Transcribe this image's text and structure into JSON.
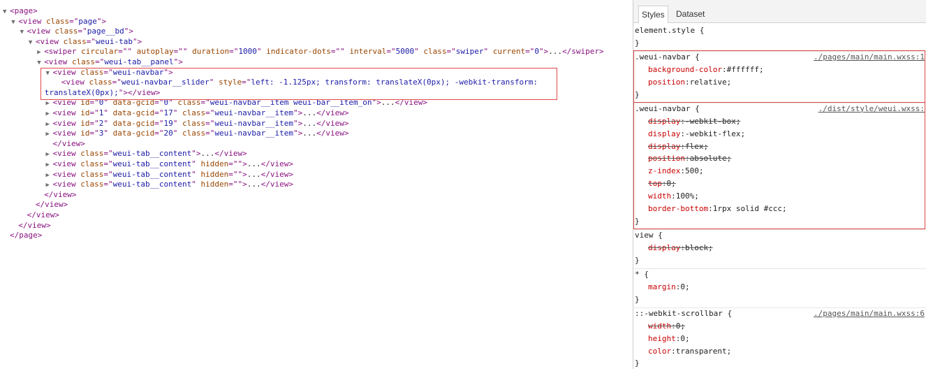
{
  "elements_panel": {
    "lines": [
      {
        "indent": 0,
        "toggle": "down",
        "html": [
          [
            "t",
            "<page>"
          ]
        ]
      },
      {
        "indent": 1,
        "toggle": "down",
        "html": [
          [
            "t",
            "<view "
          ],
          [
            "a",
            "class"
          ],
          [
            "t",
            "=\""
          ],
          [
            "v",
            "page"
          ],
          [
            "t",
            "\">"
          ]
        ]
      },
      {
        "indent": 2,
        "toggle": "down",
        "html": [
          [
            "t",
            "<view "
          ],
          [
            "a",
            "class"
          ],
          [
            "t",
            "=\""
          ],
          [
            "v",
            "page__bd"
          ],
          [
            "t",
            "\">"
          ]
        ]
      },
      {
        "indent": 3,
        "toggle": "down",
        "html": [
          [
            "t",
            "<view "
          ],
          [
            "a",
            "class"
          ],
          [
            "t",
            "=\""
          ],
          [
            "v",
            "weui-tab"
          ],
          [
            "t",
            "\">"
          ]
        ]
      },
      {
        "indent": 4,
        "toggle": "right",
        "html": [
          [
            "t",
            "<swiper "
          ],
          [
            "a",
            "circular"
          ],
          [
            "t",
            "=\"\" "
          ],
          [
            "a",
            "autoplay"
          ],
          [
            "t",
            "=\"\" "
          ],
          [
            "a",
            "duration"
          ],
          [
            "t",
            "=\""
          ],
          [
            "v",
            "1000"
          ],
          [
            "t",
            "\" "
          ],
          [
            "a",
            "indicator-dots"
          ],
          [
            "t",
            "=\"\" "
          ],
          [
            "a",
            "interval"
          ],
          [
            "t",
            "=\""
          ],
          [
            "v",
            "5000"
          ],
          [
            "t",
            "\" "
          ],
          [
            "a",
            "class"
          ],
          [
            "t",
            "=\""
          ],
          [
            "v",
            "swiper"
          ],
          [
            "t",
            "\" "
          ],
          [
            "a",
            "current"
          ],
          [
            "t",
            "=\""
          ],
          [
            "v",
            "0"
          ],
          [
            "t",
            "\">"
          ],
          [
            "x",
            "..."
          ],
          [
            "t",
            "</swiper>"
          ]
        ]
      },
      {
        "indent": 4,
        "toggle": "down",
        "html": [
          [
            "t",
            "<view "
          ],
          [
            "a",
            "class"
          ],
          [
            "t",
            "=\""
          ],
          [
            "v",
            "weui-tab__panel"
          ],
          [
            "t",
            "\">"
          ]
        ]
      },
      {
        "indent": 5,
        "toggle": "down",
        "html": [
          [
            "t",
            "<view "
          ],
          [
            "a",
            "class"
          ],
          [
            "t",
            "=\""
          ],
          [
            "v",
            "weui-navbar"
          ],
          [
            "t",
            "\">"
          ]
        ]
      },
      {
        "indent": 6,
        "toggle": "",
        "html": [
          [
            "t",
            "<view "
          ],
          [
            "a",
            "class"
          ],
          [
            "t",
            "=\""
          ],
          [
            "v",
            "weui-navbar__slider"
          ],
          [
            "t",
            "\" "
          ],
          [
            "a",
            "style"
          ],
          [
            "t",
            "=\""
          ],
          [
            "v",
            "left: -1.125px; transform: translateX(0px); -webkit-transform:"
          ]
        ]
      },
      {
        "indent": 6,
        "toggle": "",
        "html": [
          [
            "v",
            "translateX(0px);"
          ],
          [
            "t",
            "\"></view>"
          ]
        ]
      },
      {
        "indent": 5,
        "toggle": "right",
        "html": [
          [
            "t",
            "<view "
          ],
          [
            "a",
            "id"
          ],
          [
            "t",
            "=\""
          ],
          [
            "v",
            "0"
          ],
          [
            "t",
            "\" "
          ],
          [
            "a",
            "data-gcid"
          ],
          [
            "t",
            "=\""
          ],
          [
            "v",
            "0"
          ],
          [
            "t",
            "\" "
          ],
          [
            "a",
            "class"
          ],
          [
            "t",
            "=\""
          ],
          [
            "v",
            "weui-navbar__item weui-bar__item_on"
          ],
          [
            "t",
            "\">"
          ],
          [
            "x",
            "..."
          ],
          [
            "t",
            "</view>"
          ]
        ]
      },
      {
        "indent": 5,
        "toggle": "right",
        "html": [
          [
            "t",
            "<view "
          ],
          [
            "a",
            "id"
          ],
          [
            "t",
            "=\""
          ],
          [
            "v",
            "1"
          ],
          [
            "t",
            "\" "
          ],
          [
            "a",
            "data-gcid"
          ],
          [
            "t",
            "=\""
          ],
          [
            "v",
            "17"
          ],
          [
            "t",
            "\" "
          ],
          [
            "a",
            "class"
          ],
          [
            "t",
            "=\""
          ],
          [
            "v",
            "weui-navbar__item"
          ],
          [
            "t",
            "\">"
          ],
          [
            "x",
            "..."
          ],
          [
            "t",
            "</view>"
          ]
        ]
      },
      {
        "indent": 5,
        "toggle": "right",
        "html": [
          [
            "t",
            "<view "
          ],
          [
            "a",
            "id"
          ],
          [
            "t",
            "=\""
          ],
          [
            "v",
            "2"
          ],
          [
            "t",
            "\" "
          ],
          [
            "a",
            "data-gcid"
          ],
          [
            "t",
            "=\""
          ],
          [
            "v",
            "19"
          ],
          [
            "t",
            "\" "
          ],
          [
            "a",
            "class"
          ],
          [
            "t",
            "=\""
          ],
          [
            "v",
            "weui-navbar__item"
          ],
          [
            "t",
            "\">"
          ],
          [
            "x",
            "..."
          ],
          [
            "t",
            "</view>"
          ]
        ]
      },
      {
        "indent": 5,
        "toggle": "right",
        "html": [
          [
            "t",
            "<view "
          ],
          [
            "a",
            "id"
          ],
          [
            "t",
            "=\""
          ],
          [
            "v",
            "3"
          ],
          [
            "t",
            "\" "
          ],
          [
            "a",
            "data-gcid"
          ],
          [
            "t",
            "=\""
          ],
          [
            "v",
            "20"
          ],
          [
            "t",
            "\" "
          ],
          [
            "a",
            "class"
          ],
          [
            "t",
            "=\""
          ],
          [
            "v",
            "weui-navbar__item"
          ],
          [
            "t",
            "\">"
          ],
          [
            "x",
            "..."
          ],
          [
            "t",
            "</view>"
          ]
        ]
      },
      {
        "indent": 5,
        "toggle": "",
        "html": [
          [
            "t",
            "</view>"
          ]
        ]
      },
      {
        "indent": 5,
        "toggle": "right",
        "html": [
          [
            "t",
            "<view "
          ],
          [
            "a",
            "class"
          ],
          [
            "t",
            "=\""
          ],
          [
            "v",
            "weui-tab__content"
          ],
          [
            "t",
            "\">"
          ],
          [
            "x",
            "..."
          ],
          [
            "t",
            "</view>"
          ]
        ]
      },
      {
        "indent": 5,
        "toggle": "right",
        "html": [
          [
            "t",
            "<view "
          ],
          [
            "a",
            "class"
          ],
          [
            "t",
            "=\""
          ],
          [
            "v",
            "weui-tab__content"
          ],
          [
            "t",
            "\" "
          ],
          [
            "a",
            "hidden"
          ],
          [
            "t",
            "=\"\">"
          ],
          [
            "x",
            "..."
          ],
          [
            "t",
            "</view>"
          ]
        ]
      },
      {
        "indent": 5,
        "toggle": "right",
        "html": [
          [
            "t",
            "<view "
          ],
          [
            "a",
            "class"
          ],
          [
            "t",
            "=\""
          ],
          [
            "v",
            "weui-tab__content"
          ],
          [
            "t",
            "\" "
          ],
          [
            "a",
            "hidden"
          ],
          [
            "t",
            "=\"\">"
          ],
          [
            "x",
            "..."
          ],
          [
            "t",
            "</view>"
          ]
        ]
      },
      {
        "indent": 5,
        "toggle": "right",
        "html": [
          [
            "t",
            "<view "
          ],
          [
            "a",
            "class"
          ],
          [
            "t",
            "=\""
          ],
          [
            "v",
            "weui-tab__content"
          ],
          [
            "t",
            "\" "
          ],
          [
            "a",
            "hidden"
          ],
          [
            "t",
            "=\"\">"
          ],
          [
            "x",
            "..."
          ],
          [
            "t",
            "</view>"
          ]
        ]
      },
      {
        "indent": 4,
        "toggle": "",
        "html": [
          [
            "t",
            "</view>"
          ]
        ]
      },
      {
        "indent": 3,
        "toggle": "",
        "html": [
          [
            "t",
            "</view>"
          ]
        ]
      },
      {
        "indent": 2,
        "toggle": "",
        "html": [
          [
            "t",
            "</view>"
          ]
        ]
      },
      {
        "indent": 1,
        "toggle": "",
        "html": [
          [
            "t",
            "</view>"
          ]
        ]
      },
      {
        "indent": 0,
        "toggle": "",
        "html": [
          [
            "t",
            "</page>"
          ]
        ]
      }
    ]
  },
  "styles_panel": {
    "tabs": [
      {
        "label": "Styles",
        "active": true
      },
      {
        "label": "Dataset",
        "active": false
      }
    ],
    "rules": [
      {
        "selector": "element.style {",
        "source": "",
        "props": []
      },
      {
        "selector": ".weui-navbar {",
        "source": "./pages/main/main.wxss:1",
        "highlighted": true,
        "props": [
          {
            "name": "background-color",
            "value": "#ffffff;",
            "struck": false
          },
          {
            "name": "position",
            "value": "relative;",
            "struck": false
          }
        ]
      },
      {
        "selector": ".weui-navbar {",
        "source": "./dist/style/weui.wxss:",
        "highlighted": true,
        "props": [
          {
            "name": "display",
            "value": "-webkit-box;",
            "struck": true
          },
          {
            "name": "display",
            "value": "-webkit-flex;",
            "struck": false
          },
          {
            "name": "display",
            "value": "flex;",
            "struck": true
          },
          {
            "name": "position",
            "value": "absolute;",
            "struck": true
          },
          {
            "name": "z-index",
            "value": "500;",
            "struck": false
          },
          {
            "name": "top",
            "value": "0;",
            "struck": true
          },
          {
            "name": "width",
            "value": "100%;",
            "struck": false
          },
          {
            "name": "border-bottom",
            "value": "1rpx solid #ccc;",
            "struck": false
          }
        ]
      },
      {
        "selector": "view {",
        "source": "",
        "props": [
          {
            "name": "display",
            "value": "block;",
            "struck": true
          }
        ]
      },
      {
        "selector": "* {",
        "source": "",
        "props": [
          {
            "name": "margin",
            "value": "0;",
            "struck": false
          }
        ]
      },
      {
        "selector": "::-webkit-scrollbar {",
        "source": "./pages/main/main.wxss:6",
        "props": [
          {
            "name": "width",
            "value": "0;",
            "struck": true
          },
          {
            "name": "height",
            "value": "0;",
            "struck": false
          },
          {
            "name": "color",
            "value": "transparent;",
            "struck": false
          }
        ]
      }
    ],
    "close_brace": "}"
  }
}
